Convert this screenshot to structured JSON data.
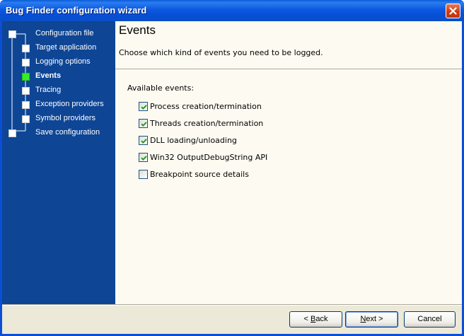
{
  "window": {
    "title": "Bug Finder configuration wizard",
    "icons": {
      "close": "close-icon"
    },
    "accent": "#0b4fd8"
  },
  "sidebar": {
    "background": "#0e4595",
    "active_marker_color": "#33ee22",
    "steps": [
      {
        "label": "Configuration file",
        "active": false,
        "level": 0
      },
      {
        "label": "Target application",
        "active": false,
        "level": 1
      },
      {
        "label": "Logging options",
        "active": false,
        "level": 1
      },
      {
        "label": "Events",
        "active": true,
        "level": 1
      },
      {
        "label": "Tracing",
        "active": false,
        "level": 1
      },
      {
        "label": "Exception providers",
        "active": false,
        "level": 1
      },
      {
        "label": "Symbol providers",
        "active": false,
        "level": 1
      },
      {
        "label": "Save configuration",
        "active": false,
        "level": 0
      }
    ]
  },
  "main": {
    "title": "Events",
    "subtitle": "Choose which kind of events you need to be logged.",
    "available_label": "Available events:",
    "events": [
      {
        "label": "Process creation/termination",
        "checked": true
      },
      {
        "label": "Threads creation/termination",
        "checked": true
      },
      {
        "label": "DLL loading/unloading",
        "checked": true
      },
      {
        "label": "Win32 OutputDebugString API",
        "checked": true
      },
      {
        "label": "Breakpoint source details",
        "checked": false
      }
    ]
  },
  "buttons": {
    "back": {
      "prefix": "< ",
      "mnemonic": "B",
      "rest": "ack"
    },
    "next": {
      "mnemonic": "N",
      "rest": "ext",
      "suffix": " >"
    },
    "cancel": "Cancel"
  }
}
